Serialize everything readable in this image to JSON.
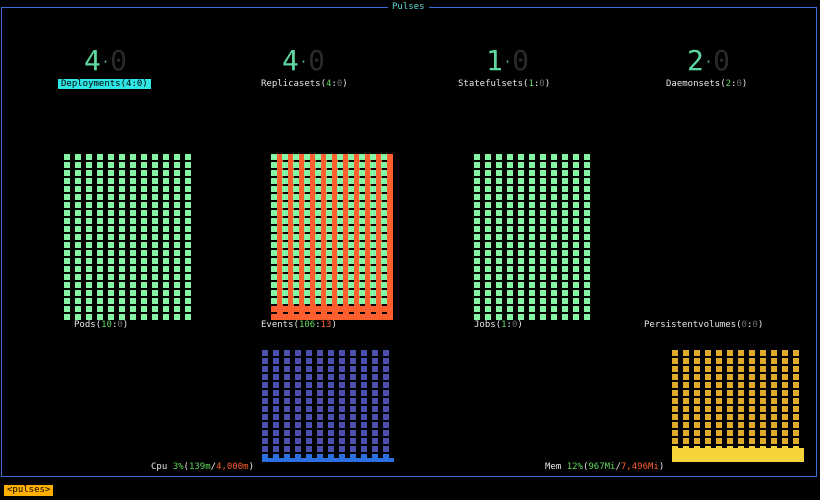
{
  "frame_title": "Pulses",
  "gauges": [
    {
      "name": "deployments",
      "big_a": "4",
      "big_b": "0",
      "label": "Deployments",
      "ok": "4",
      "fail": "0",
      "selected": true
    },
    {
      "name": "replicasets",
      "big_a": "4",
      "big_b": "0",
      "label": "Replicasets",
      "ok": "4",
      "fail": "0",
      "selected": false
    },
    {
      "name": "statefulsets",
      "big_a": "1",
      "big_b": "0",
      "label": "Statefulsets",
      "ok": "1",
      "fail": "0",
      "selected": false
    },
    {
      "name": "daemonsets",
      "big_a": "2",
      "big_b": "0",
      "label": "Daemonsets",
      "ok": "2",
      "fail": "0",
      "selected": false
    }
  ],
  "charts": {
    "pods": {
      "label": "Pods",
      "ok": "10",
      "fail": "0"
    },
    "events": {
      "label": "Events",
      "ok": "106",
      "fail": "13"
    },
    "jobs": {
      "label": "Jobs",
      "ok": "1",
      "fail": "0"
    },
    "pvs": {
      "label": "Persistentvolumes",
      "ok": "0",
      "fail": "0"
    },
    "cpu": {
      "label": "Cpu",
      "pct": "3%",
      "used": "139m",
      "total": "4,000m"
    },
    "mem": {
      "label": "Mem",
      "pct": "12%",
      "used": "967Mi",
      "total": "7,496Mi"
    }
  },
  "colors": {
    "ok": "#87f5a6",
    "fail": "#ff5f2f",
    "cpu": "#4b4fae",
    "cpu_base": "#2b6fe0",
    "mem": "#e0aa2a",
    "mem_base": "#f5d33a"
  },
  "footer_tag": "<pulses>"
}
